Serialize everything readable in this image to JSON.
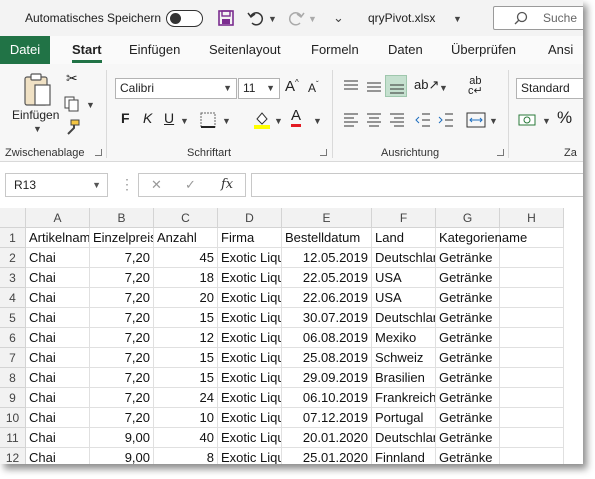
{
  "titlebar": {
    "autosave_label": "Automatisches Speichern",
    "filename": "qryPivot.xlsx",
    "search_placeholder": "Suche"
  },
  "tabs": [
    "Datei",
    "Start",
    "Einfügen",
    "Seitenlayout",
    "Formeln",
    "Daten",
    "Überprüfen",
    "Ansi"
  ],
  "ribbon": {
    "paste_label": "Einfügen",
    "font_name": "Calibri",
    "font_size": "11",
    "number_format": "Standard",
    "groups": {
      "clipboard": "Zwischenablage",
      "font": "Schriftart",
      "alignment": "Ausrichtung",
      "number_partial": "Za"
    },
    "font_buttons": {
      "bold": "F",
      "italic": "K",
      "underline": "U"
    },
    "colors": {
      "fill": "#ffff00",
      "font": "#e31b23",
      "accent": "#217346"
    }
  },
  "formula_bar": {
    "name_box": "R13",
    "cancel": "✕",
    "enter": "✓",
    "fx": "fx",
    "formula": ""
  },
  "sheet": {
    "columns": [
      "A",
      "B",
      "C",
      "D",
      "E",
      "F",
      "G",
      "H"
    ],
    "row_numbers": [
      "1",
      "2",
      "3",
      "4",
      "5",
      "6",
      "7",
      "8",
      "9",
      "10",
      "11",
      "12"
    ],
    "header_row": [
      "Artikelname",
      "Einzelpreis",
      "Anzahl",
      "Firma",
      "Bestelldatum",
      "Land",
      "Kategoriename",
      ""
    ],
    "rows": [
      [
        "Chai",
        "7,20",
        "45",
        "Exotic Liquids",
        "12.05.2019",
        "Deutschland",
        "Getränke"
      ],
      [
        "Chai",
        "7,20",
        "18",
        "Exotic Liquids",
        "22.05.2019",
        "USA",
        "Getränke"
      ],
      [
        "Chai",
        "7,20",
        "20",
        "Exotic Liquids",
        "22.06.2019",
        "USA",
        "Getränke"
      ],
      [
        "Chai",
        "7,20",
        "15",
        "Exotic Liquids",
        "30.07.2019",
        "Deutschland",
        "Getränke"
      ],
      [
        "Chai",
        "7,20",
        "12",
        "Exotic Liquids",
        "06.08.2019",
        "Mexiko",
        "Getränke"
      ],
      [
        "Chai",
        "7,20",
        "15",
        "Exotic Liquids",
        "25.08.2019",
        "Schweiz",
        "Getränke"
      ],
      [
        "Chai",
        "7,20",
        "15",
        "Exotic Liquids",
        "29.09.2019",
        "Brasilien",
        "Getränke"
      ],
      [
        "Chai",
        "7,20",
        "24",
        "Exotic Liquids",
        "06.10.2019",
        "Frankreich",
        "Getränke"
      ],
      [
        "Chai",
        "7,20",
        "10",
        "Exotic Liquids",
        "07.12.2019",
        "Portugal",
        "Getränke"
      ],
      [
        "Chai",
        "9,00",
        "40",
        "Exotic Liquids",
        "20.01.2020",
        "Deutschland",
        "Getränke"
      ],
      [
        "Chai",
        "9,00",
        "8",
        "Exotic Liquids",
        "25.01.2020",
        "Finnland",
        "Getränke"
      ]
    ]
  }
}
